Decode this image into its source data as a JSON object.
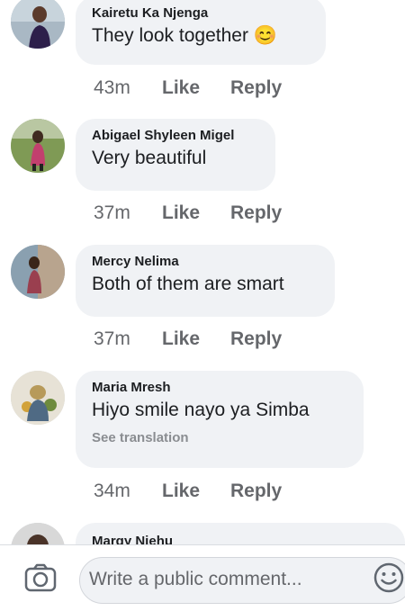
{
  "comments": [
    {
      "author": "Kairetu Ka Njenga",
      "text": "They look together 😊",
      "time": "43m",
      "like": "Like",
      "reply": "Reply",
      "avatar_icon": "profile-photo"
    },
    {
      "author": "Abigael Shyleen Migel",
      "text": "Very beautiful",
      "time": "37m",
      "like": "Like",
      "reply": "Reply",
      "avatar_icon": "profile-photo"
    },
    {
      "author": "Mercy Nelima",
      "text": "Both of them are smart",
      "time": "37m",
      "like": "Like",
      "reply": "Reply",
      "avatar_icon": "profile-photo"
    },
    {
      "author": "Maria Mresh",
      "text": "Hiyo smile nayo ya Simba",
      "see_translation": "See translation",
      "time": "34m",
      "like": "Like",
      "reply": "Reply",
      "avatar_icon": "profile-photo"
    },
    {
      "author": "Margy Njehu",
      "avatar_icon": "profile-photo"
    }
  ],
  "composer": {
    "placeholder": "Write a public comment...",
    "camera_icon": "camera-icon",
    "emoji_icon": "emoji-icon"
  },
  "colors": {
    "bubble_bg": "#f0f2f5",
    "meta_text": "#65676b",
    "primary_text": "#1c1e21"
  }
}
